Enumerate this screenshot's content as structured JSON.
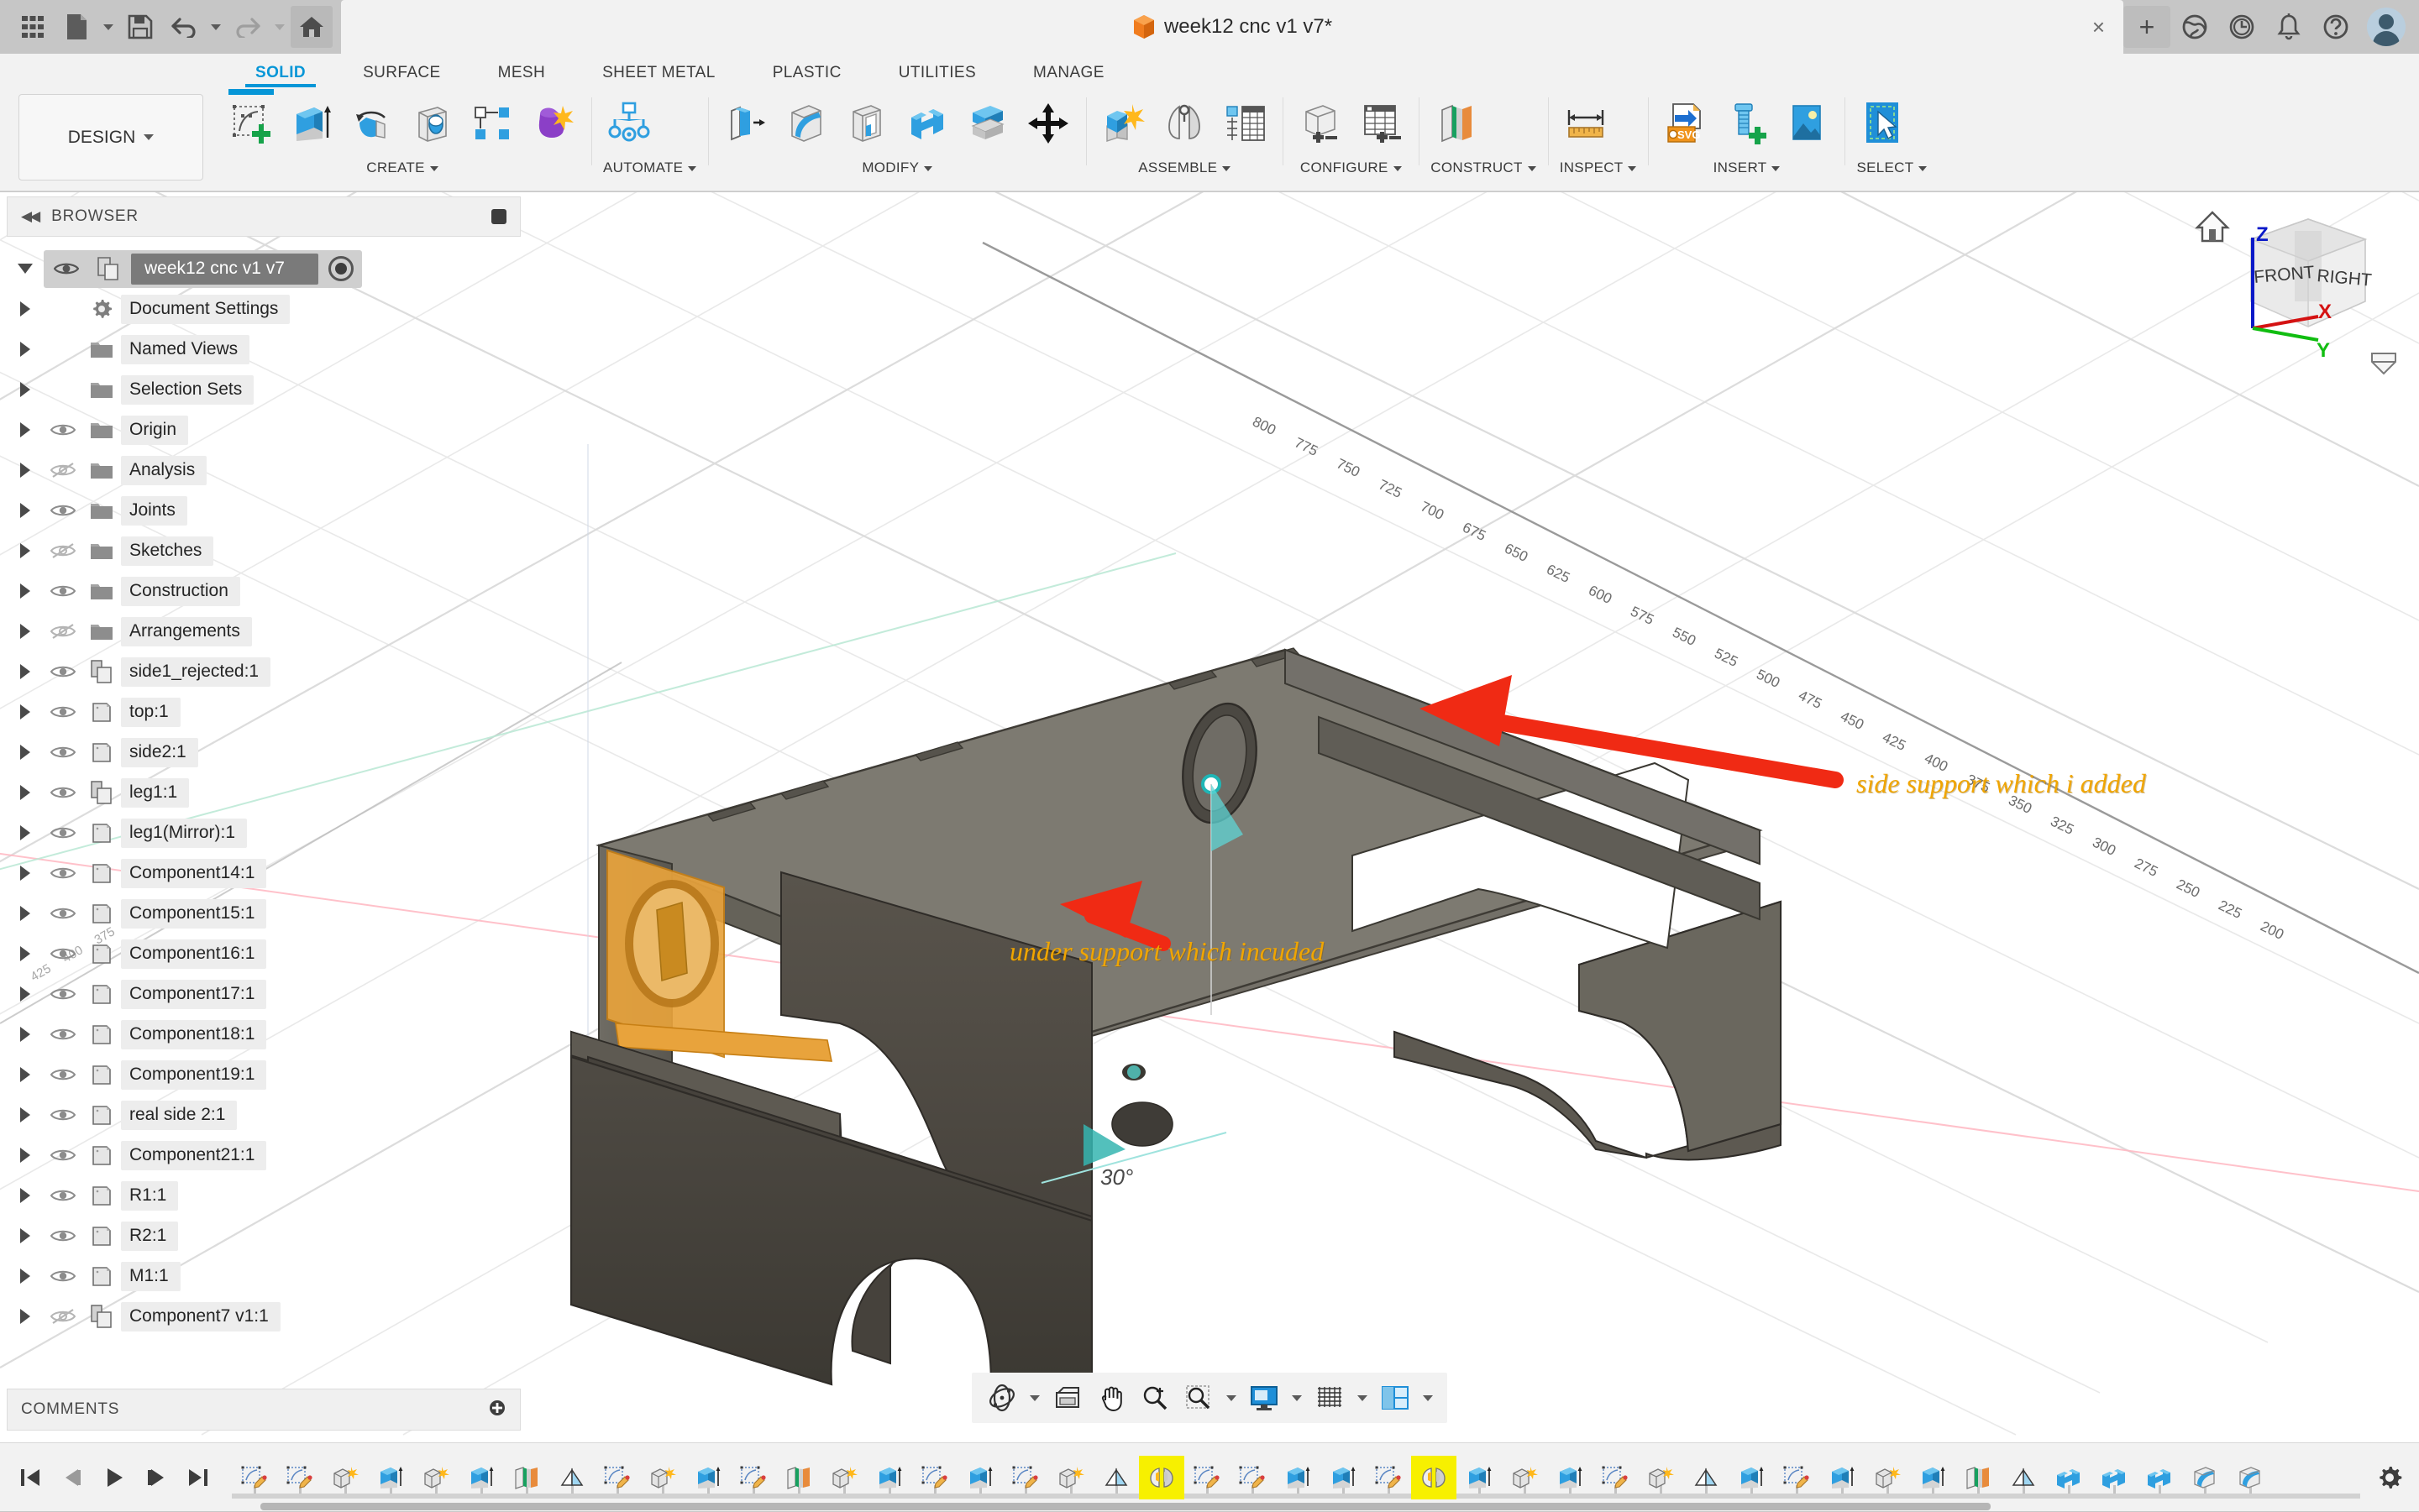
{
  "app": {
    "title_bar": {
      "quick_access": [
        {
          "name": "grid-menu-icon",
          "label": "Show Data Panel"
        },
        {
          "name": "new-file-icon",
          "label": "File"
        },
        {
          "name": "save-icon",
          "label": "Save"
        },
        {
          "name": "undo-icon",
          "label": "Undo"
        },
        {
          "name": "redo-icon",
          "label": "Redo"
        },
        {
          "name": "home-icon",
          "label": "Home"
        }
      ],
      "document_tab": "week12 cnc v1 v7*",
      "close_label": "×",
      "new_tab_label": "+",
      "right_icons": [
        {
          "name": "extensions-icon",
          "label": "Extensions"
        },
        {
          "name": "job-status-icon",
          "label": "Job Status"
        },
        {
          "name": "notifications-icon",
          "label": "Notifications"
        },
        {
          "name": "help-icon",
          "label": "Help"
        },
        {
          "name": "account-avatar",
          "label": "Account"
        }
      ]
    },
    "ribbon": {
      "workspace": "DESIGN",
      "tabs": [
        {
          "label": "SOLID",
          "active": true
        },
        {
          "label": "SURFACE",
          "active": false
        },
        {
          "label": "MESH",
          "active": false
        },
        {
          "label": "SHEET METAL",
          "active": false
        },
        {
          "label": "PLASTIC",
          "active": false
        },
        {
          "label": "UTILITIES",
          "active": false
        },
        {
          "label": "MANAGE",
          "active": false
        }
      ],
      "active_tab_color": "#0696d7",
      "groups": [
        {
          "label": "CREATE",
          "dropdown": true,
          "tools": [
            {
              "name": "create-sketch-icon",
              "label": "Create Sketch",
              "selected": true
            },
            {
              "name": "extrude-icon",
              "label": "Extrude"
            },
            {
              "name": "revolve-icon",
              "label": "Revolve"
            },
            {
              "name": "hole-icon",
              "label": "Hole"
            },
            {
              "name": "pattern-icon",
              "label": "Rectangular Pattern"
            },
            {
              "name": "form-icon",
              "label": "Create Form"
            }
          ]
        },
        {
          "label": "AUTOMATE",
          "dropdown": true,
          "tools": [
            {
              "name": "automated-modeling-icon",
              "label": "Automated Modeling"
            }
          ]
        },
        {
          "label": "MODIFY",
          "dropdown": true,
          "tools": [
            {
              "name": "press-pull-icon",
              "label": "Press Pull"
            },
            {
              "name": "fillet-icon",
              "label": "Fillet"
            },
            {
              "name": "shell-icon",
              "label": "Shell"
            },
            {
              "name": "combine-icon",
              "label": "Combine"
            },
            {
              "name": "split-face-icon",
              "label": "Split Body"
            },
            {
              "name": "move-copy-icon",
              "label": "Move/Copy"
            }
          ]
        },
        {
          "label": "ASSEMBLE",
          "dropdown": true,
          "tools": [
            {
              "name": "new-component-icon",
              "label": "New Component"
            },
            {
              "name": "joint-icon",
              "label": "Joint"
            },
            {
              "name": "bill-of-materials-icon",
              "label": "Bill of Materials"
            }
          ]
        },
        {
          "label": "CONFIGURE",
          "dropdown": true,
          "tools": [
            {
              "name": "create-configuration-icon",
              "label": "Create Configuration"
            },
            {
              "name": "configuration-table-icon",
              "label": "Configuration Table"
            }
          ]
        },
        {
          "label": "CONSTRUCT",
          "dropdown": true,
          "tools": [
            {
              "name": "offset-plane-icon",
              "label": "Offset Plane"
            }
          ]
        },
        {
          "label": "INSPECT",
          "dropdown": true,
          "tools": [
            {
              "name": "measure-icon",
              "label": "Measure"
            }
          ]
        },
        {
          "label": "INSERT",
          "dropdown": true,
          "tools": [
            {
              "name": "insert-svg-icon",
              "label": "Insert SVG"
            },
            {
              "name": "insert-mcmaster-icon",
              "label": "Insert McMaster-Carr Component"
            },
            {
              "name": "canvas-icon",
              "label": "Canvas"
            }
          ]
        },
        {
          "label": "SELECT",
          "dropdown": true,
          "tools": [
            {
              "name": "select-icon",
              "label": "Select"
            }
          ]
        }
      ]
    },
    "browser": {
      "header": "BROWSER",
      "root": {
        "label": "week12 cnc v1 v7",
        "selected": true,
        "visible": true,
        "expanded": true
      },
      "items": [
        {
          "label": "Document Settings",
          "icon": "gear-icon",
          "eye": "none"
        },
        {
          "label": "Named Views",
          "icon": "folder-icon",
          "eye": "none"
        },
        {
          "label": "Selection Sets",
          "icon": "folder-icon",
          "eye": "none"
        },
        {
          "label": "Origin",
          "icon": "folder-icon",
          "eye": "visible"
        },
        {
          "label": "Analysis",
          "icon": "folder-icon",
          "eye": "hidden"
        },
        {
          "label": "Joints",
          "icon": "folder-icon",
          "eye": "visible"
        },
        {
          "label": "Sketches",
          "icon": "folder-icon",
          "eye": "hidden"
        },
        {
          "label": "Construction",
          "icon": "folder-icon",
          "eye": "visible"
        },
        {
          "label": "Arrangements",
          "icon": "folder-icon",
          "eye": "hidden"
        },
        {
          "label": "side1_rejected:1",
          "icon": "component-icon",
          "eye": "visible"
        },
        {
          "label": "top:1",
          "icon": "body-icon",
          "eye": "visible"
        },
        {
          "label": "side2:1",
          "icon": "body-icon",
          "eye": "visible"
        },
        {
          "label": "leg1:1",
          "icon": "component-icon",
          "eye": "visible"
        },
        {
          "label": "leg1(Mirror):1",
          "icon": "body-icon",
          "eye": "visible"
        },
        {
          "label": "Component14:1",
          "icon": "body-icon",
          "eye": "visible"
        },
        {
          "label": "Component15:1",
          "icon": "body-icon",
          "eye": "visible"
        },
        {
          "label": "Component16:1",
          "icon": "body-icon",
          "eye": "visible"
        },
        {
          "label": "Component17:1",
          "icon": "body-icon",
          "eye": "visible"
        },
        {
          "label": "Component18:1",
          "icon": "body-icon",
          "eye": "visible"
        },
        {
          "label": "Component19:1",
          "icon": "body-icon",
          "eye": "visible"
        },
        {
          "label": "real side 2:1",
          "icon": "body-icon",
          "eye": "visible"
        },
        {
          "label": "Component21:1",
          "icon": "body-icon",
          "eye": "visible"
        },
        {
          "label": "R1:1",
          "icon": "body-icon",
          "eye": "visible"
        },
        {
          "label": "R2:1",
          "icon": "body-icon",
          "eye": "visible"
        },
        {
          "label": "M1:1",
          "icon": "body-icon",
          "eye": "visible"
        },
        {
          "label": "Component7 v1:1",
          "icon": "component-icon",
          "eye": "hidden"
        }
      ]
    },
    "comments": {
      "header": "COMMENTS",
      "add_label": "+"
    },
    "viewport": {
      "annotations": [
        {
          "text": "side support which i added",
          "color": "#f0a500"
        },
        {
          "text": "under support which incuded",
          "color": "#f0a500"
        }
      ],
      "dimension": "30°",
      "grid_labels": [
        "200",
        "225",
        "250",
        "275",
        "300",
        "325",
        "350",
        "375",
        "400",
        "425",
        "450",
        "475",
        "500",
        "525",
        "550",
        "575",
        "600",
        "625",
        "650",
        "675",
        "700",
        "725",
        "750",
        "775",
        "800"
      ],
      "view_cube": {
        "home": "home-icon",
        "faces": [
          "FRONT",
          "RIGHT"
        ],
        "axes": [
          {
            "label": "Z",
            "color": "#0a19c8"
          },
          {
            "label": "X",
            "color": "#d41212"
          },
          {
            "label": "Y",
            "color": "#11bd11"
          }
        ]
      },
      "nav_bar": [
        {
          "name": "orbit-icon",
          "label": "Orbit",
          "caret": true
        },
        {
          "name": "look-at-icon",
          "label": "Look At",
          "caret": false
        },
        {
          "name": "pan-icon",
          "label": "Pan",
          "caret": false
        },
        {
          "name": "zoom-icon",
          "label": "Zoom",
          "caret": false
        },
        {
          "name": "zoom-window-icon",
          "label": "Fit",
          "caret": true
        },
        {
          "name": "display-settings-icon",
          "label": "Display Settings",
          "caret": true
        },
        {
          "name": "grid-snaps-icon",
          "label": "Grid and Snaps",
          "caret": true
        },
        {
          "name": "viewports-icon",
          "label": "Viewports",
          "caret": true
        }
      ]
    },
    "timeline": {
      "playback": [
        {
          "name": "go-to-beginning-icon",
          "label": "Go to Beginning"
        },
        {
          "name": "step-back-icon",
          "label": "Step Back"
        },
        {
          "name": "play-icon",
          "label": "Play Playback"
        },
        {
          "name": "step-forward-icon",
          "label": "Step Forward"
        },
        {
          "name": "go-to-end-icon",
          "label": "Go to End"
        }
      ],
      "features": [
        {
          "name": "sketch-feature-icon",
          "label": "Sketch",
          "highlight": false
        },
        {
          "name": "sketch-feature-icon",
          "label": "Sketch",
          "highlight": false
        },
        {
          "name": "new-component-feature-icon",
          "label": "New Component",
          "highlight": false
        },
        {
          "name": "extrude-feature-icon",
          "label": "Extrude",
          "highlight": false
        },
        {
          "name": "new-component-feature-icon",
          "label": "New Component",
          "highlight": false
        },
        {
          "name": "extrude-feature-icon",
          "label": "Extrude",
          "highlight": false
        },
        {
          "name": "construction-plane-feature-icon",
          "label": "Construction Plane",
          "highlight": false
        },
        {
          "name": "mirror-plane-feature-icon",
          "label": "Plane",
          "highlight": false
        },
        {
          "name": "sketch-feature-icon",
          "label": "Sketch",
          "highlight": false
        },
        {
          "name": "new-component-feature-icon",
          "label": "New Component",
          "highlight": false
        },
        {
          "name": "extrude-feature-icon",
          "label": "Extrude",
          "highlight": false
        },
        {
          "name": "sketch-feature-icon",
          "label": "Sketch",
          "highlight": false
        },
        {
          "name": "construction-plane-feature-icon",
          "label": "Construction Plane",
          "highlight": false
        },
        {
          "name": "new-component-feature-icon",
          "label": "New Component",
          "highlight": false
        },
        {
          "name": "extrude-feature-icon",
          "label": "Extrude",
          "highlight": false
        },
        {
          "name": "sketch-feature-icon",
          "label": "Sketch",
          "highlight": false
        },
        {
          "name": "extrude-feature-icon",
          "label": "Extrude",
          "highlight": false
        },
        {
          "name": "sketch-feature-icon",
          "label": "Sketch",
          "highlight": false
        },
        {
          "name": "new-component-feature-icon",
          "label": "New Component",
          "highlight": false
        },
        {
          "name": "mirror-plane-feature-icon",
          "label": "Plane",
          "highlight": false
        },
        {
          "name": "mirror-feature-icon",
          "label": "Mirror",
          "highlight": true
        },
        {
          "name": "sketch-feature-icon",
          "label": "Sketch",
          "highlight": false
        },
        {
          "name": "sketch-feature-icon",
          "label": "Sketch",
          "highlight": false
        },
        {
          "name": "extrude-feature-icon",
          "label": "Extrude",
          "highlight": false
        },
        {
          "name": "extrude-feature-icon",
          "label": "Extrude",
          "highlight": false
        },
        {
          "name": "sketch-feature-icon",
          "label": "Sketch",
          "highlight": false
        },
        {
          "name": "mirror-feature-icon",
          "label": "Mirror",
          "highlight": true
        },
        {
          "name": "extrude-feature-icon",
          "label": "Extrude",
          "highlight": false
        },
        {
          "name": "new-component-feature-icon",
          "label": "New Component",
          "highlight": false
        },
        {
          "name": "extrude-feature-icon",
          "label": "Extrude",
          "highlight": false
        },
        {
          "name": "sketch-feature-icon",
          "label": "Sketch",
          "highlight": false
        },
        {
          "name": "new-component-feature-icon",
          "label": "New Component",
          "highlight": false
        },
        {
          "name": "mirror-plane-feature-icon",
          "label": "Plane",
          "highlight": false
        },
        {
          "name": "extrude-feature-icon",
          "label": "Extrude",
          "highlight": false
        },
        {
          "name": "sketch-feature-icon",
          "label": "Sketch",
          "highlight": false
        },
        {
          "name": "extrude-feature-icon",
          "label": "Extrude",
          "highlight": false
        },
        {
          "name": "new-component-feature-icon",
          "label": "New Component",
          "highlight": false
        },
        {
          "name": "extrude-feature-icon",
          "label": "Extrude",
          "highlight": false
        },
        {
          "name": "construction-plane-feature-icon",
          "label": "Construction Plane",
          "highlight": false
        },
        {
          "name": "mirror-plane-feature-icon",
          "label": "Plane",
          "highlight": false
        },
        {
          "name": "combine-feature-icon",
          "label": "Combine",
          "highlight": false
        },
        {
          "name": "combine-feature-icon",
          "label": "Combine",
          "highlight": false
        },
        {
          "name": "combine-feature-icon",
          "label": "Combine",
          "highlight": false
        },
        {
          "name": "fillet-feature-icon",
          "label": "Fillet",
          "highlight": false
        },
        {
          "name": "fillet-feature-icon",
          "label": "Fillet",
          "highlight": false
        }
      ],
      "settings": {
        "name": "timeline-settings-icon",
        "label": "Timeline Settings"
      }
    }
  }
}
